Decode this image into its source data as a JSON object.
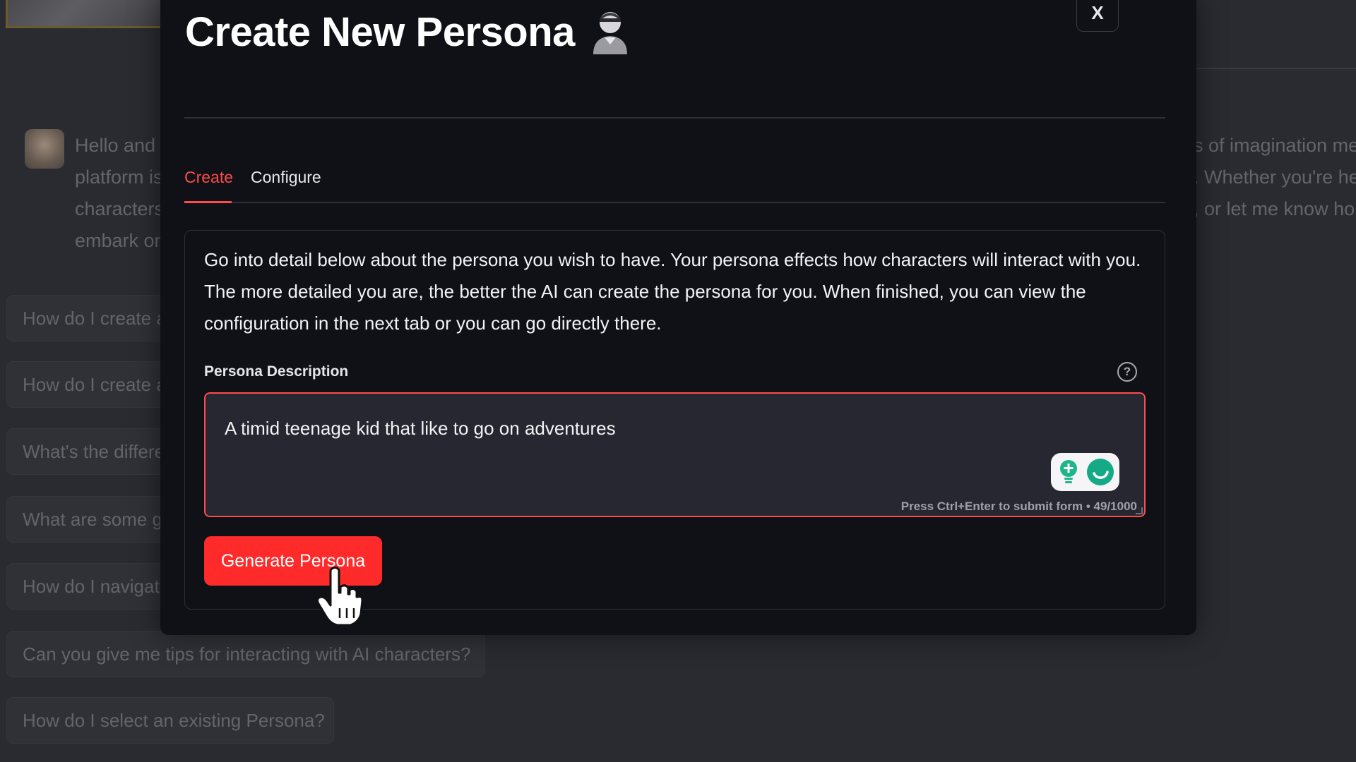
{
  "background": {
    "message_left_lines": [
      "Hello and",
      "platform is",
      "characters",
      "embark on"
    ],
    "message_right_lines": [
      "s of imagination me",
      ". Whether you're he",
      ", or let me know ho",
      ""
    ],
    "suggestions": [
      "How do I create a",
      "How do I create a",
      "What's the differe",
      "What are some g",
      "How do I navigat",
      "Can you give me tips for interacting with AI characters?",
      "How do I select an existing Persona?"
    ]
  },
  "modal": {
    "title": "Create New Persona",
    "title_icon": "person-icon",
    "close_label": "X",
    "tabs": [
      {
        "label": "Create",
        "active": true
      },
      {
        "label": "Configure",
        "active": false
      }
    ],
    "intro": "Go into detail below about the persona you wish to have. Your persona effects how characters will interact with you. The more detailed you are, the better the AI can create the persona for you. When finished, you can view the configuration in the next tab or you can go directly there.",
    "field_label": "Persona Description",
    "help_icon": "?",
    "textarea_value": "A timid teenage kid that like to go on adventures",
    "textarea_hint": "Press Ctrl+Enter to submit form • 49/1000",
    "generate_label": "Generate Persona"
  },
  "colors": {
    "accent": "#ff4b4b",
    "button": "#ff2b2b",
    "modal_bg": "#0f1117",
    "page_bg": "#2a2b31"
  }
}
